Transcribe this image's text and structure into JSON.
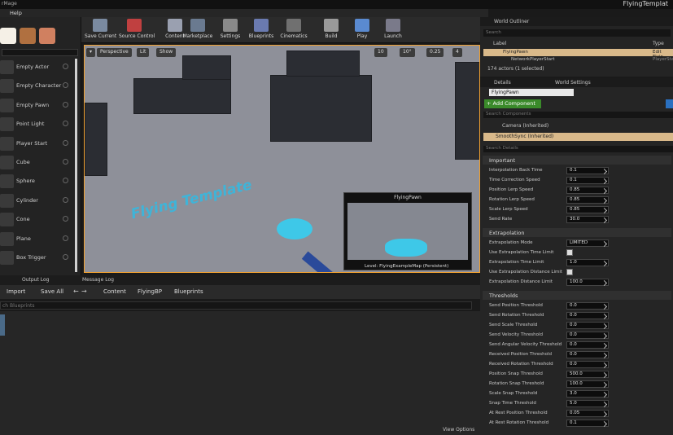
{
  "window": {
    "title_left": "rMage",
    "title_right": "FlyingTemplat"
  },
  "menu": {
    "help": "Help"
  },
  "modes": {
    "search_placeholder": "",
    "items": [
      "Empty Actor",
      "Empty Character",
      "Empty Pawn",
      "Point Light",
      "Player Start",
      "Cube",
      "Sphere",
      "Cylinder",
      "Cone",
      "Plane",
      "Box Trigger"
    ]
  },
  "toolbar": {
    "buttons": [
      "Save Current",
      "Source Control",
      "Content",
      "Marketplace",
      "Settings",
      "Blueprints",
      "Cinematics",
      "Build",
      "Play",
      "Launch"
    ]
  },
  "viewport": {
    "perspective": "Perspective",
    "lit": "Lit",
    "show": "Show",
    "grid_size": "10",
    "rotation_snap": "10°",
    "scale_snap": "0.25",
    "camera_speed": "4",
    "scene_text": "Flying Template",
    "pip_title": "FlyingPawn",
    "level_text": "Level: FlyingExampleMap (Persistent)"
  },
  "bottom": {
    "tab_output": "Output Log",
    "tab_message": "Message Log",
    "import": "Import",
    "save_all": "Save All",
    "crumbs": [
      "Content",
      "FlyingBP",
      "Blueprints"
    ],
    "search_placeholder": "ch Blueprints",
    "view_options": "View Options"
  },
  "outliner": {
    "tab": "World Outliner",
    "search_placeholder": "Search",
    "col_label": "Label",
    "col_type": "Type",
    "rows": [
      {
        "label": "FlyingPawn",
        "type": "Edit Flyin"
      },
      {
        "label": "NetworkPlayerStart",
        "type": "PlayerSta"
      }
    ],
    "status": "174 actors (1 selected)"
  },
  "details": {
    "tab_details": "Details",
    "tab_world": "World Settings",
    "name": "FlyingPawn",
    "add_component": "+ Add Component",
    "components_search": "Search Components",
    "comp_camera": "Camera (Inherited)",
    "comp_selected": "SmoothSync (Inherited)",
    "details_search": "Search Details",
    "sections": [
      {
        "title": "Important",
        "rows": [
          {
            "label": "Interpolation Back Time",
            "value": "0.1"
          },
          {
            "label": "Time Correction Speed",
            "value": "0.1"
          },
          {
            "label": "Position Lerp Speed",
            "value": "0.85"
          },
          {
            "label": "Rotation Lerp Speed",
            "value": "0.85"
          },
          {
            "label": "Scale Lerp Speed",
            "value": "0.85"
          },
          {
            "label": "Send Rate",
            "value": "30.0"
          }
        ]
      },
      {
        "title": "Extrapolation",
        "rows": [
          {
            "label": "Extrapolation Mode",
            "value": "LIMITED"
          },
          {
            "label": "Use Extrapolation Time Limit",
            "value": ""
          },
          {
            "label": "Extrapolation Time Limit",
            "value": "1.0"
          },
          {
            "label": "Use Extrapolation Distance Limit",
            "value": ""
          },
          {
            "label": "Extrapolation Distance Limit",
            "value": "100.0"
          }
        ]
      },
      {
        "title": "Thresholds",
        "rows": [
          {
            "label": "Send Position Threshold",
            "value": "0.0"
          },
          {
            "label": "Send Rotation Threshold",
            "value": "0.0"
          },
          {
            "label": "Send Scale Threshold",
            "value": "0.0"
          },
          {
            "label": "Send Velocity Threshold",
            "value": "0.0"
          },
          {
            "label": "Send Angular Velocity Threshold",
            "value": "0.0"
          },
          {
            "label": "Received Position Threshold",
            "value": "0.0"
          },
          {
            "label": "Received Rotation Threshold",
            "value": "0.0"
          },
          {
            "label": "Position Snap Threshold",
            "value": "500.0"
          },
          {
            "label": "Rotation Snap Threshold",
            "value": "100.0"
          },
          {
            "label": "Scale Snap Threshold",
            "value": "3.0"
          },
          {
            "label": "Snap Time Threshold",
            "value": "5.0"
          },
          {
            "label": "At Rest Position Threshold",
            "value": "0.05"
          },
          {
            "label": "At Rest Rotation Threshold",
            "value": "0.1"
          }
        ]
      }
    ]
  },
  "colors": {
    "accent": "#f0a030",
    "add_green": "#3a8a2a",
    "selected_row": "#d9b98a"
  }
}
